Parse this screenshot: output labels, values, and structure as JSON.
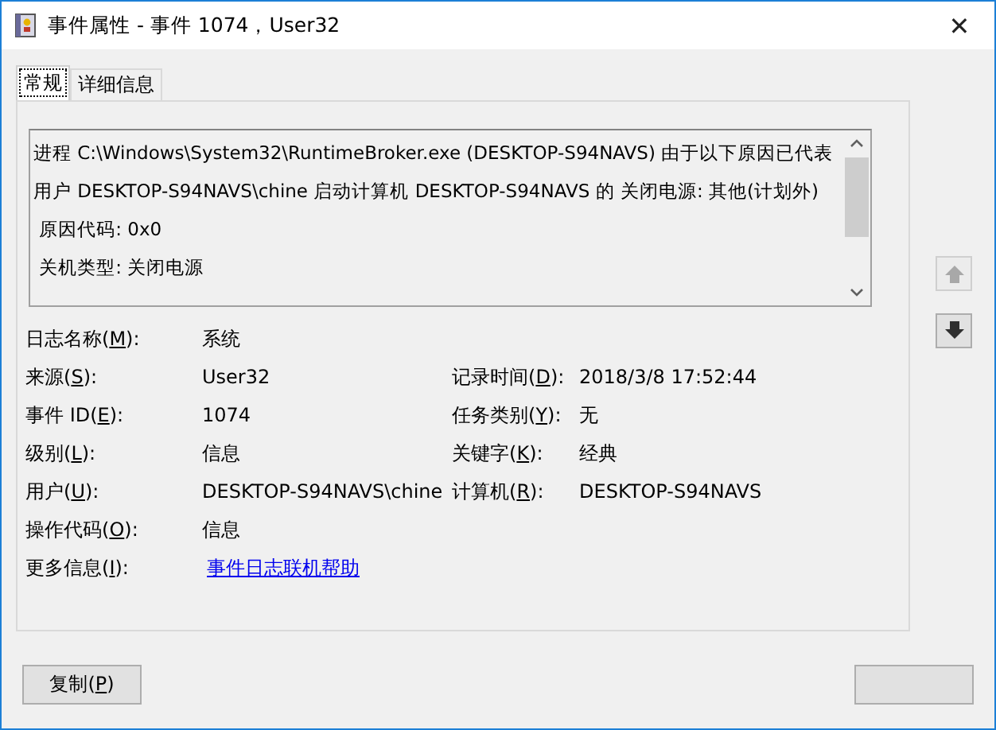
{
  "window": {
    "title": "事件属性 - 事件 1074，User32",
    "close": "✕"
  },
  "tabs": [
    {
      "label": "常规",
      "selected": true
    },
    {
      "label": "详细信息",
      "selected": false
    }
  ],
  "description": {
    "paragraph": "进程 C:\\Windows\\System32\\RuntimeBroker.exe (DESKTOP-S94NAVS) 由于以下原因已代表用户 DESKTOP-S94NAVS\\chine 启动计算机 DESKTOP-S94NAVS 的 关闭电源: 其他(计划外)",
    "lines": [
      " 原因代码: 0x0",
      " 关机类型: 关闭电源"
    ]
  },
  "fields": [
    {
      "label": {
        "text": "日志名称(",
        "key": "M",
        "after": "):"
      },
      "value": "系统"
    },
    {
      "label": {
        "text": "来源(",
        "key": "S",
        "after": "):"
      },
      "value": "User32",
      "label_2": {
        "text": "记录时间(",
        "key": "D",
        "after": "):"
      },
      "value_2": "2018/3/8 17:52:44"
    },
    {
      "label": {
        "text": "事件 ID(",
        "key": "E",
        "after": "):"
      },
      "value": "1074",
      "label_2": {
        "text": "任务类别(",
        "key": "Y",
        "after": "):"
      },
      "value_2": "无"
    },
    {
      "label": {
        "text": "级别(",
        "key": "L",
        "after": "):"
      },
      "value": "信息",
      "label_2": {
        "text": "关键字(",
        "key": "K",
        "after": "):"
      },
      "value_2": "经典"
    },
    {
      "label": {
        "text": "用户(",
        "key": "U",
        "after": "):"
      },
      "value": "DESKTOP-S94NAVS\\chine",
      "label_2": {
        "text": "计算机(",
        "key": "R",
        "after": "):"
      },
      "value_2": "DESKTOP-S94NAVS"
    },
    {
      "label": {
        "text": "操作代码(",
        "key": "O",
        "after": "):"
      },
      "value": "信息"
    },
    {
      "label": {
        "text": "更多信息(",
        "key": "I",
        "after": "):"
      },
      "link": "事件日志联机帮助"
    }
  ],
  "nav_buttons": [
    {
      "kind": "up",
      "disabled": true
    },
    {
      "kind": "down",
      "disabled": false
    }
  ],
  "buttons": [
    {
      "kind": "labeled",
      "label": {
        "text": "复制(",
        "key": "P",
        "after": ")"
      }
    },
    {
      "kind": "unlabeled"
    }
  ]
}
